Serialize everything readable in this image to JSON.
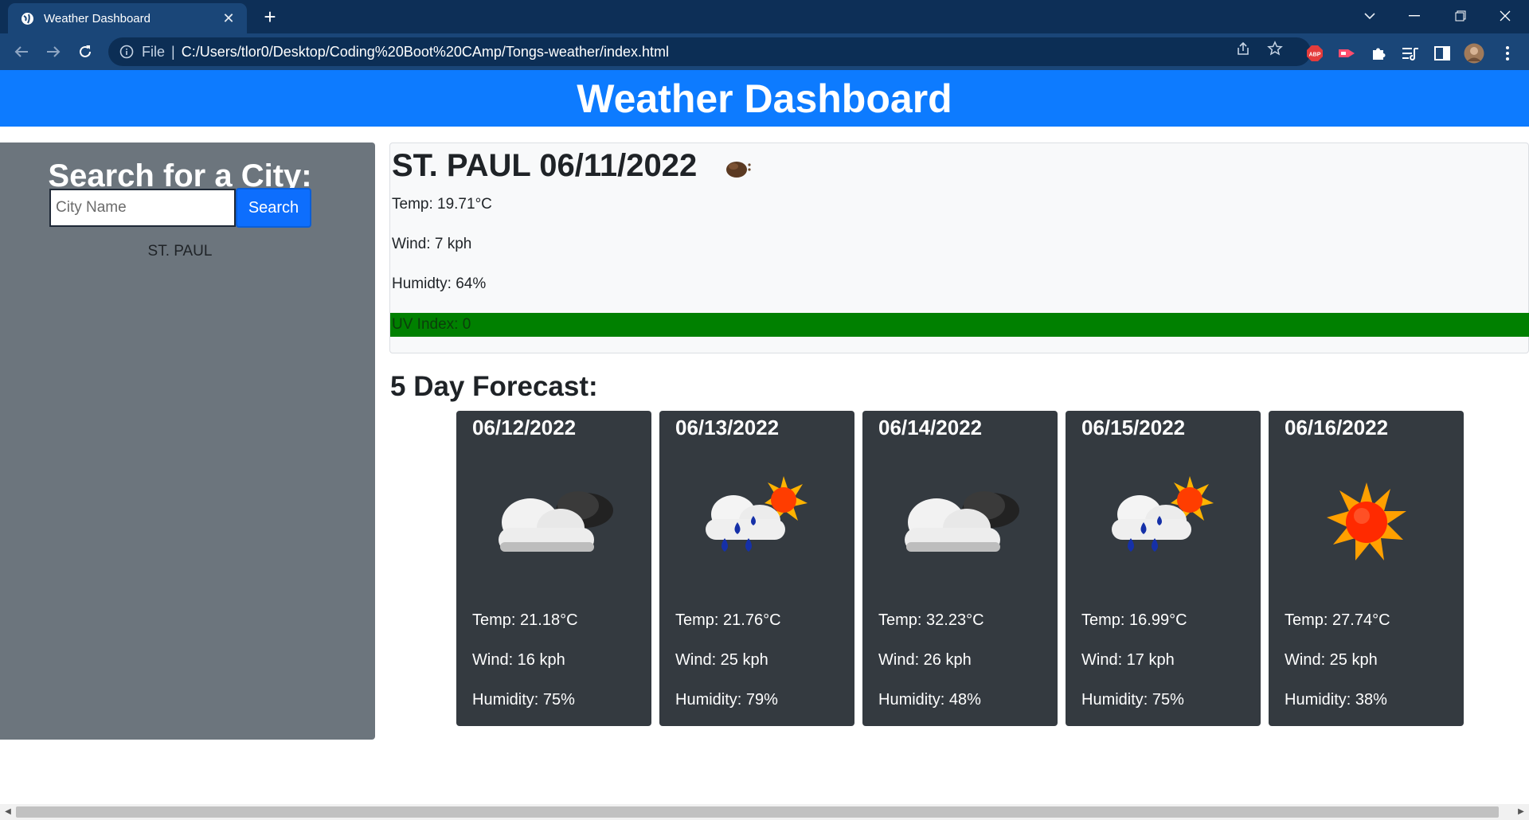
{
  "browser": {
    "tab_title": "Weather Dashboard",
    "address_scheme": "File",
    "address_url": "C:/Users/tlor0/Desktop/Coding%20Boot%20CAmp/Tongs-weather/index.html",
    "extensions": [
      "abp-icon",
      "cast-icon",
      "puzzle-icon",
      "reading-list-icon",
      "side-panel-icon",
      "profile-avatar"
    ],
    "abp_label": "ABP"
  },
  "header": {
    "title": "Weather Dashboard"
  },
  "sidebar": {
    "heading": "Search for a City:",
    "search_placeholder": "City Name",
    "search_value": "",
    "search_button": "Search",
    "history": [
      "ST. PAUL"
    ]
  },
  "current": {
    "title": "ST. PAUL 06/11/2022",
    "icon": "few-clouds-night-icon",
    "temp": "Temp: 19.71°C",
    "wind": "Wind: 7 kph",
    "humidity": "Humidty: 64%",
    "uv": "UV Index: 0",
    "uv_color": "#008000"
  },
  "forecast": {
    "title": "5 Day Forecast:",
    "days": [
      {
        "date": "06/12/2022",
        "icon": "cloudy-icon",
        "temp": "Temp: 21.18°C",
        "wind": "Wind: 16 kph",
        "humidity": "Humidity: 75%"
      },
      {
        "date": "06/13/2022",
        "icon": "rain-sun-icon",
        "temp": "Temp: 21.76°C",
        "wind": "Wind: 25 kph",
        "humidity": "Humidity: 79%"
      },
      {
        "date": "06/14/2022",
        "icon": "cloudy-icon",
        "temp": "Temp: 32.23°C",
        "wind": "Wind: 26 kph",
        "humidity": "Humidity: 48%"
      },
      {
        "date": "06/15/2022",
        "icon": "rain-sun-icon",
        "temp": "Temp: 16.99°C",
        "wind": "Wind: 17 kph",
        "humidity": "Humidity: 75%"
      },
      {
        "date": "06/16/2022",
        "icon": "sun-icon",
        "temp": "Temp: 27.74°C",
        "wind": "Wind: 25 kph",
        "humidity": "Humidity: 38%"
      }
    ]
  },
  "colors": {
    "browser_frame": "#0d2f57",
    "toolbar": "#1a4678",
    "header": "#0d7bff",
    "sidebar": "#6c757d",
    "card": "#343a40",
    "button": "#0d6efd"
  }
}
